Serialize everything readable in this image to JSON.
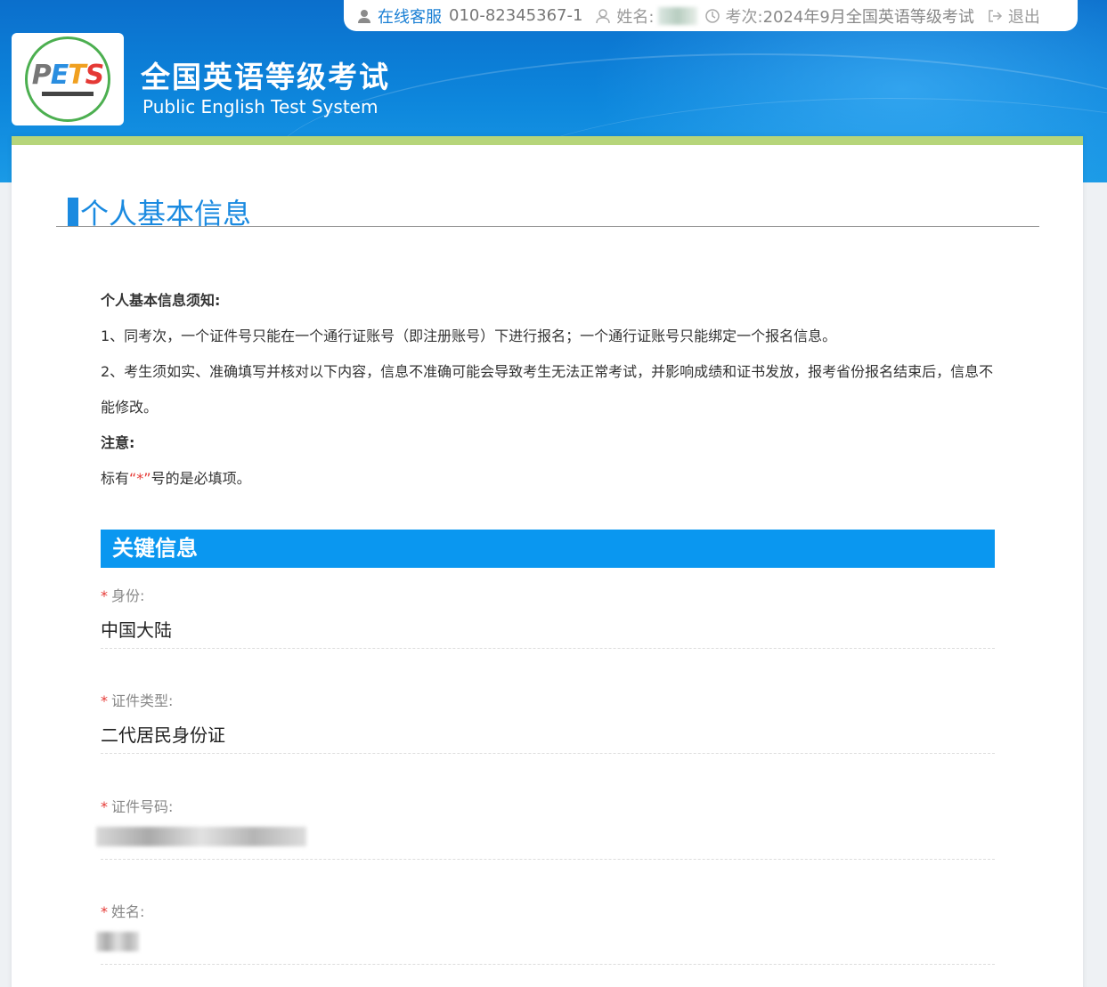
{
  "topbar": {
    "service_label": "在线客服",
    "phone": "010-82345367-1",
    "name_label": "姓名:",
    "session_label": "考次:",
    "session_value": "2024年9月全国英语等级考试",
    "logout_label": "退出"
  },
  "brand": {
    "title": "全国英语等级考试",
    "subtitle": "Public English Test System",
    "logo_text": "PETS"
  },
  "page": {
    "title": "个人基本信息"
  },
  "notice": {
    "heading": "个人基本信息须知:",
    "item1": "1、同考次，一个证件号只能在一个通行证账号（即注册账号）下进行报名；一个通行证账号只能绑定一个报名信息。",
    "item2": "2、考生须如实、准确填写并核对以下内容，信息不准确可能会导致考生无法正常考试，并影响成绩和证书发放，报考省份报名结束后，信息不能修改。",
    "note_heading": "注意:",
    "note_prefix": "标有",
    "note_star": "“*”",
    "note_suffix": "号的是必填项。"
  },
  "section": {
    "title": "关键信息"
  },
  "fields": [
    {
      "required": "*",
      "label": "身份:",
      "value": "中国大陆"
    },
    {
      "required": "*",
      "label": "证件类型:",
      "value": "二代居民身份证"
    },
    {
      "required": "*",
      "label": "证件号码:",
      "value": ""
    },
    {
      "required": "*",
      "label": "姓名:",
      "value": ""
    }
  ],
  "colors": {
    "header_blue": "#0d86dc",
    "accent_blue": "#0a97f0",
    "green_strip": "#b6d57a",
    "required_red": "#e53935"
  }
}
